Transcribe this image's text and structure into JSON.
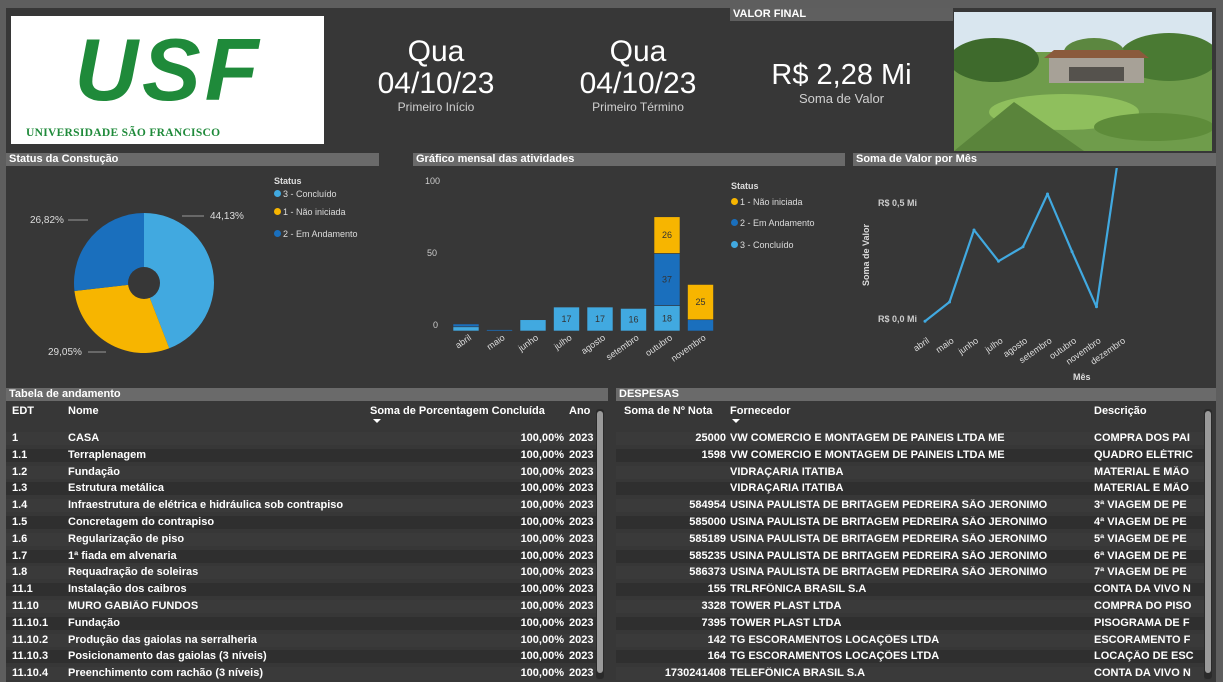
{
  "logo": {
    "letters": "USF",
    "subtitle": "UNIVERSIDADE SÃO FRANCISCO"
  },
  "kpis": {
    "start": {
      "day": "Qua",
      "date": "04/10/23",
      "label": "Primeiro Início"
    },
    "end": {
      "day": "Qua",
      "date": "04/10/23",
      "label": "Primeiro Término"
    },
    "final": {
      "header": "VALOR FINAL",
      "value": "R$ 2,28 Mi",
      "label": "Soma de Valor"
    }
  },
  "colors": {
    "concluido": "#41a9e0",
    "nao_iniciada": "#f7b500",
    "em_andamento": "#1a6fbd",
    "line": "#41a9e0",
    "panel": "#373737",
    "header": "#6a6a6a"
  },
  "status_panel": {
    "title": "Status da Constução",
    "legend_title": "Status",
    "legend": [
      "3 - Concluído",
      "1 - Não iniciada",
      "2 - Em Andamento"
    ],
    "labels": [
      "44,13%",
      "29,05%",
      "26,82%"
    ]
  },
  "monthly_panel": {
    "title": "Gráfico mensal das atividades",
    "legend_title": "Status",
    "legend": [
      "1 - Não iniciada",
      "2 - Em Andamento",
      "3 - Concluído"
    ],
    "y_ticks": [
      "100",
      "50",
      "0"
    ]
  },
  "valor_panel": {
    "title": "Soma de Valor por Mês",
    "y_ticks": [
      "R$ 0,5 Mi",
      "R$ 0,0 Mi"
    ],
    "ylabel": "Soma de Valor",
    "xlabel": "Mês"
  },
  "chart_data": [
    {
      "type": "pie",
      "title": "Status da Constução",
      "labels": [
        "3 - Concluído",
        "1 - Não iniciada",
        "2 - Em Andamento"
      ],
      "values": [
        44.13,
        29.05,
        26.82
      ],
      "colors": [
        "#41a9e0",
        "#f7b500",
        "#1a6fbd"
      ]
    },
    {
      "type": "bar",
      "title": "Gráfico mensal das atividades",
      "stacked": true,
      "categories": [
        "abril",
        "maio",
        "junho",
        "julho",
        "agosto",
        "setembro",
        "outubro",
        "novembro"
      ],
      "series": [
        {
          "name": "1 - Não iniciada",
          "values": [
            0,
            0,
            0,
            0,
            0,
            0,
            26,
            25
          ],
          "color": "#f7b500"
        },
        {
          "name": "2 - Em Andamento",
          "values": [
            2,
            1,
            0,
            0,
            0,
            0,
            37,
            8
          ],
          "color": "#1a6fbd"
        },
        {
          "name": "3 - Concluído",
          "values": [
            3,
            0,
            8,
            17,
            17,
            16,
            18,
            0
          ],
          "color": "#41a9e0"
        }
      ],
      "data_labels": [
        [
          "",
          "",
          "",
          "",
          "",
          "",
          "26",
          "25"
        ],
        [
          "",
          "",
          "",
          "",
          "",
          "",
          "37",
          ""
        ],
        [
          "",
          "",
          "",
          "17",
          "17",
          "16",
          "18",
          ""
        ]
      ],
      "ylim": [
        0,
        100
      ],
      "y_ticks": [
        0,
        50,
        100
      ]
    },
    {
      "type": "line",
      "title": "Soma de Valor por Mês",
      "xlabel": "Mês",
      "ylabel": "Soma de Valor",
      "categories": [
        "abril",
        "maio",
        "junho",
        "julho",
        "agosto",
        "setembro",
        "outubro",
        "novembro",
        "dezembro"
      ],
      "values": [
        0.02,
        0.1,
        0.4,
        0.27,
        0.33,
        0.55,
        0.31,
        0.08,
        0.78
      ],
      "y_ticks": [
        "R$ 0,5 Mi",
        "R$ 0,0 Mi"
      ]
    }
  ],
  "tabela": {
    "title": "Tabela de andamento",
    "columns": [
      "EDT",
      "Nome",
      "Soma de Porcentagem Concluída",
      "Ano"
    ],
    "rows": [
      [
        "1",
        "CASA",
        "100,00%",
        "2023"
      ],
      [
        "1.1",
        "Terraplenagem",
        "100,00%",
        "2023"
      ],
      [
        "1.2",
        "Fundação",
        "100,00%",
        "2023"
      ],
      [
        "1.3",
        "Estrutura metálica",
        "100,00%",
        "2023"
      ],
      [
        "1.4",
        "Infraestrutura de elétrica e hidráulica sob contrapiso",
        "100,00%",
        "2023"
      ],
      [
        "1.5",
        "Concretagem do contrapiso",
        "100,00%",
        "2023"
      ],
      [
        "1.6",
        "Regularização de piso",
        "100,00%",
        "2023"
      ],
      [
        "1.7",
        "1ª fiada em alvenaria",
        "100,00%",
        "2023"
      ],
      [
        "1.8",
        "Requadração de soleiras",
        "100,00%",
        "2023"
      ],
      [
        "11.1",
        "Instalação dos caibros",
        "100,00%",
        "2023"
      ],
      [
        "11.10",
        "MURO GABIÃO FUNDOS",
        "100,00%",
        "2023"
      ],
      [
        "11.10.1",
        "Fundação",
        "100,00%",
        "2023"
      ],
      [
        "11.10.2",
        "Produção das gaiolas na serralheria",
        "100,00%",
        "2023"
      ],
      [
        "11.10.3",
        "Posicionamento das gaiolas (3 níveis)",
        "100,00%",
        "2023"
      ],
      [
        "11.10.4",
        "Preenchimento com rachão (3 níveis)",
        "100,00%",
        "2023"
      ]
    ]
  },
  "despesas": {
    "title": "DESPESAS",
    "columns": [
      "Soma de Nº Nota",
      "Fornecedor",
      "Descrição"
    ],
    "rows": [
      [
        "25000",
        "VW COMERCIO E MONTAGEM DE PAINEIS LTDA ME",
        "COMPRA DOS PAI"
      ],
      [
        "1598",
        "VW COMERCIO E MONTAGEM DE PAINEIS LTDA ME",
        "QUADRO ELÉTRIC"
      ],
      [
        "",
        "VIDRAÇARIA ITATIBA",
        "MATERIAL E MÃO"
      ],
      [
        "",
        "VIDRAÇARIA ITATIBA",
        "MATERIAL E MÃO"
      ],
      [
        "584954",
        "USINA PAULISTA DE BRITAGEM PEDREIRA SÃO JERONIMO",
        "3ª VIAGEM DE PE"
      ],
      [
        "585000",
        "USINA PAULISTA DE BRITAGEM PEDREIRA SÃO JERONIMO",
        "4ª VIAGEM DE PE"
      ],
      [
        "585189",
        "USINA PAULISTA DE BRITAGEM PEDREIRA SÃO JERONIMO",
        "5ª VIAGEM DE PE"
      ],
      [
        "585235",
        "USINA PAULISTA DE BRITAGEM PEDREIRA SÃO JERONIMO",
        "6ª VIAGEM DE PE"
      ],
      [
        "586373",
        "USINA PAULISTA DE BRITAGEM PEDREIRA SÃO JERONIMO",
        "7ª VIAGEM DE PE"
      ],
      [
        "155",
        "TRLRFÔNICA BRASIL S.A",
        "CONTA DA VIVO N"
      ],
      [
        "3328",
        "TOWER PLAST LTDA",
        "COMPRA DO PISO"
      ],
      [
        "7395",
        "TOWER PLAST LTDA",
        "PISOGRAMA DE F"
      ],
      [
        "142",
        "TG ESCORAMENTOS LOCAÇÕES LTDA",
        "ESCORAMENTO F"
      ],
      [
        "164",
        "TG ESCORAMENTOS LOCAÇÕES LTDA",
        "LOCAÇÃO DE ESC"
      ],
      [
        "1730241408",
        "TELEFÔNICA BRASIL S.A",
        "CONTA DA VIVO N"
      ]
    ]
  }
}
